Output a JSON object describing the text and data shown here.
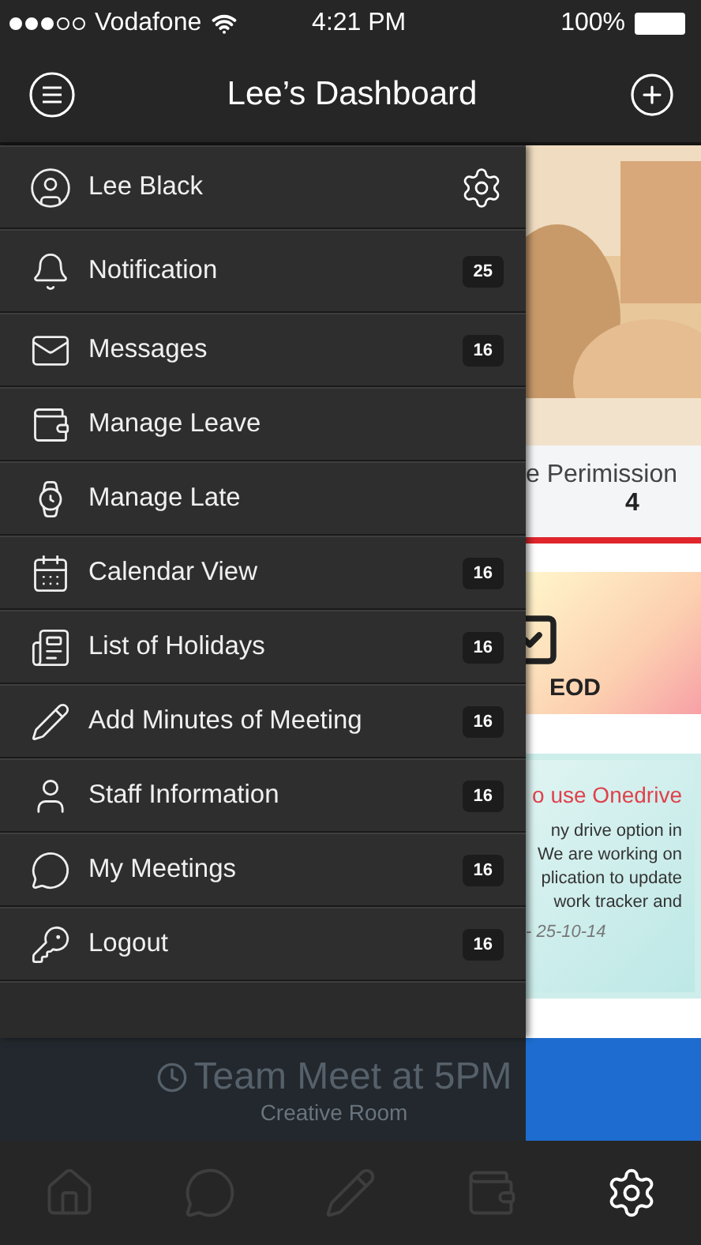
{
  "status_bar": {
    "carrier": "Vodafone",
    "time": "4:21 PM",
    "battery": "100%"
  },
  "header": {
    "title": "Lee’s Dashboard"
  },
  "drawer": {
    "profile": {
      "name": "Lee Black"
    },
    "items": [
      {
        "kind": "bell",
        "label": "Notification",
        "badge": "25"
      },
      {
        "kind": "mail",
        "label": "Messages",
        "badge": "16"
      },
      {
        "kind": "wallet",
        "label": "Manage Leave"
      },
      {
        "kind": "watch",
        "label": "Manage Late"
      },
      {
        "kind": "calendar",
        "label": "Calendar View",
        "badge": "16"
      },
      {
        "kind": "newspaper",
        "label": "List of Holidays",
        "badge": "16"
      },
      {
        "kind": "pencil",
        "label": "Add Minutes of Meeting",
        "badge": "16"
      },
      {
        "kind": "user",
        "label": "Staff Information",
        "badge": "16"
      },
      {
        "kind": "chat",
        "label": "My Meetings",
        "badge": "16"
      },
      {
        "kind": "key",
        "label": "Logout",
        "badge": "16"
      }
    ]
  },
  "dashboard": {
    "stat": {
      "label": "e Perimission",
      "value": "4"
    },
    "task_card": {
      "label": "EOD"
    },
    "notice": {
      "title": "o use Onedrive",
      "lines": [
        "ny drive option in",
        "We are working on",
        "plication to update",
        "work tracker and"
      ],
      "footer": "- 25-10-14"
    },
    "banner": {
      "title": "Team Meet at 5PM",
      "subtitle": "Creative Room"
    }
  },
  "tab_bar": [
    {
      "kind": "home",
      "selected": false
    },
    {
      "kind": "chat",
      "selected": false
    },
    {
      "kind": "pencil",
      "selected": false
    },
    {
      "kind": "wallet",
      "selected": false
    },
    {
      "kind": "settings",
      "selected": true
    }
  ]
}
